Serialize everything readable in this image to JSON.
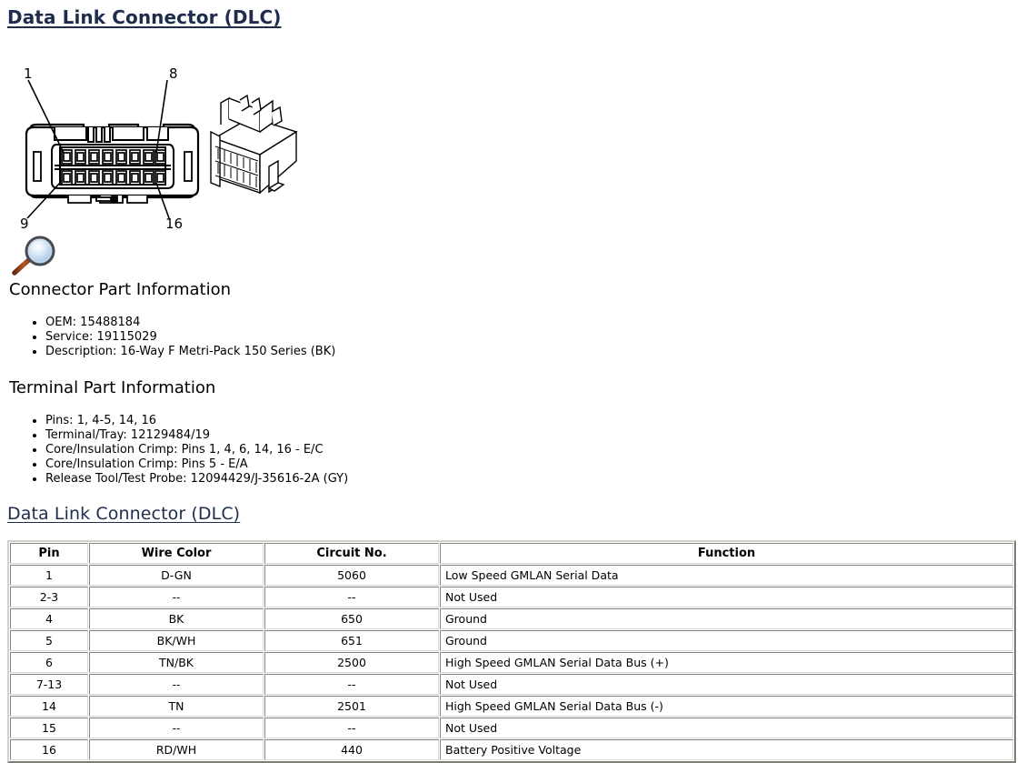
{
  "page": {
    "title_top": "Data Link Connector (DLC)",
    "title_table": "Data Link Connector (DLC)",
    "link_color": "#1f2d4d",
    "background_color": "#ffffff"
  },
  "diagram": {
    "name": "dlc-connector-face-view",
    "pin_callouts": [
      {
        "label": "1",
        "position": "top-left"
      },
      {
        "label": "8",
        "position": "top-right"
      },
      {
        "label": "9",
        "position": "bottom-left"
      },
      {
        "label": "16",
        "position": "bottom-right"
      }
    ],
    "cavity_rows": 2,
    "cavities_per_row": 8,
    "magnifier_icon": "magnifying-glass-icon"
  },
  "connector_part_information": {
    "heading": "Connector Part Information",
    "items": [
      "OEM: 15488184",
      "Service: 19115029",
      "Description: 16-Way F Metri-Pack 150 Series (BK)"
    ]
  },
  "terminal_part_information": {
    "heading": "Terminal Part Information",
    "items": [
      "Pins: 1, 4-5, 14, 16",
      "Terminal/Tray: 12129484/19",
      "Core/Insulation Crimp: Pins 1, 4, 6, 14, 16 - E/C",
      "Core/Insulation Crimp: Pins 5 - E/A",
      "Release Tool/Test Probe: 12094429/J-35616-2A (GY)"
    ]
  },
  "pin_table": {
    "columns": [
      "Pin",
      "Wire Color",
      "Circuit No.",
      "Function"
    ],
    "rows": [
      {
        "pin": "1",
        "wire_color": "D-GN",
        "circuit_no": "5060",
        "function": "Low Speed GMLAN Serial Data"
      },
      {
        "pin": "2-3",
        "wire_color": "--",
        "circuit_no": "--",
        "function": "Not Used"
      },
      {
        "pin": "4",
        "wire_color": "BK",
        "circuit_no": "650",
        "function": "Ground"
      },
      {
        "pin": "5",
        "wire_color": "BK/WH",
        "circuit_no": "651",
        "function": "Ground"
      },
      {
        "pin": "6",
        "wire_color": "TN/BK",
        "circuit_no": "2500",
        "function": "High Speed GMLAN Serial Data Bus (+)"
      },
      {
        "pin": "7-13",
        "wire_color": "--",
        "circuit_no": "--",
        "function": "Not Used"
      },
      {
        "pin": "14",
        "wire_color": "TN",
        "circuit_no": "2501",
        "function": "High Speed GMLAN Serial Data Bus (-)"
      },
      {
        "pin": "15",
        "wire_color": "--",
        "circuit_no": "--",
        "function": "Not Used"
      },
      {
        "pin": "16",
        "wire_color": "RD/WH",
        "circuit_no": "440",
        "function": "Battery Positive Voltage"
      }
    ]
  }
}
